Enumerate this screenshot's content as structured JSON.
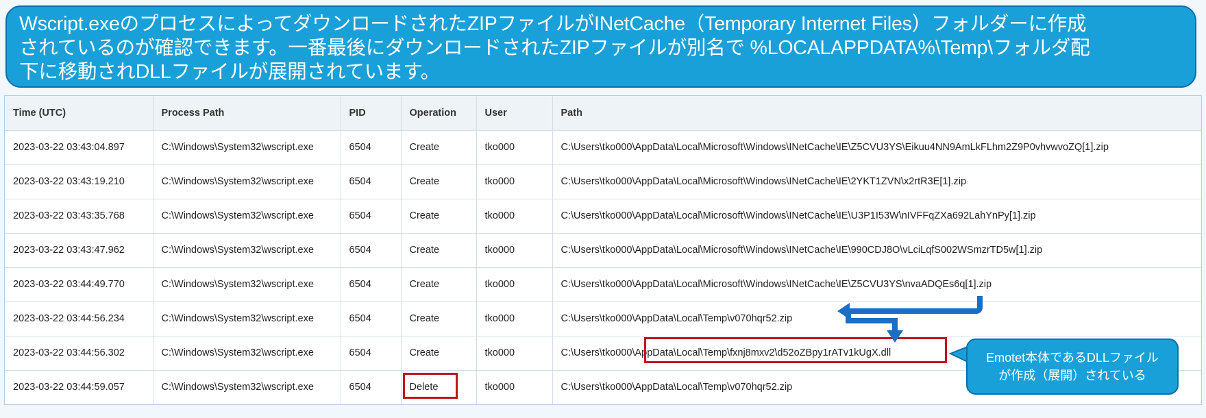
{
  "banner": {
    "line1": "Wscript.exeのプロセスによってダウンロードされたZIPファイルがINetCache（Temporary Internet Files）フォルダーに作成",
    "line2": "されているのが確認できます。一番最後にダウンロードされたZIPファイルが別名で %LOCALAPPDATA%\\Temp\\フォルダ配",
    "line3": "下に移動されDLLファイルが展開されています。"
  },
  "table": {
    "columns": [
      "Time (UTC)",
      "Process Path",
      "PID",
      "Operation",
      "User",
      "Path"
    ],
    "rows": [
      [
        "2023-03-22 03:43:04.897",
        "C:\\Windows\\System32\\wscript.exe",
        "6504",
        "Create",
        "tko000",
        "C:\\Users\\tko000\\AppData\\Local\\Microsoft\\Windows\\INetCache\\IE\\Z5CVU3YS\\Eikuu4NN9AmLkFLhm2Z9P0vhvwvoZQ[1].zip"
      ],
      [
        "2023-03-22 03:43:19.210",
        "C:\\Windows\\System32\\wscript.exe",
        "6504",
        "Create",
        "tko000",
        "C:\\Users\\tko000\\AppData\\Local\\Microsoft\\Windows\\INetCache\\IE\\2YKT1ZVN\\x2rtR3E[1].zip"
      ],
      [
        "2023-03-22 03:43:35.768",
        "C:\\Windows\\System32\\wscript.exe",
        "6504",
        "Create",
        "tko000",
        "C:\\Users\\tko000\\AppData\\Local\\Microsoft\\Windows\\INetCache\\IE\\U3P1I53W\\nIVFFqZXa692LahYnPy[1].zip"
      ],
      [
        "2023-03-22 03:43:47.962",
        "C:\\Windows\\System32\\wscript.exe",
        "6504",
        "Create",
        "tko000",
        "C:\\Users\\tko000\\AppData\\Local\\Microsoft\\Windows\\INetCache\\IE\\990CDJ8O\\vLciLqfS002WSmzrTD5w[1].zip"
      ],
      [
        "2023-03-22 03:44:49.770",
        "C:\\Windows\\System32\\wscript.exe",
        "6504",
        "Create",
        "tko000",
        "C:\\Users\\tko000\\AppData\\Local\\Microsoft\\Windows\\INetCache\\IE\\Z5CVU3YS\\nvaADQEs6q[1].zip"
      ],
      [
        "2023-03-22 03:44:56.234",
        "C:\\Windows\\System32\\wscript.exe",
        "6504",
        "Create",
        "tko000",
        "C:\\Users\\tko000\\AppData\\Local\\Temp\\v070hqr52.zip"
      ],
      [
        "2023-03-22 03:44:56.302",
        "C:\\Windows\\System32\\wscript.exe",
        "6504",
        "Create",
        "tko000",
        "C:\\Users\\tko000\\AppData\\Local\\Temp\\fxnj8mxv2\\d52oZBpy1rATv1kUgX.dll"
      ],
      [
        "2023-03-22 03:44:59.057",
        "C:\\Windows\\System32\\wscript.exe",
        "6504",
        "Delete",
        "tko000",
        "C:\\Users\\tko000\\AppData\\Local\\Temp\\v070hqr52.zip"
      ]
    ]
  },
  "callout": {
    "line1": "Emotet本体であるDLLファイル",
    "line2": "が作成（展開）されている"
  },
  "colors": {
    "accent": "#1aa0d8",
    "highlight": "#c0141c",
    "arrow": "#1a6fc4"
  }
}
